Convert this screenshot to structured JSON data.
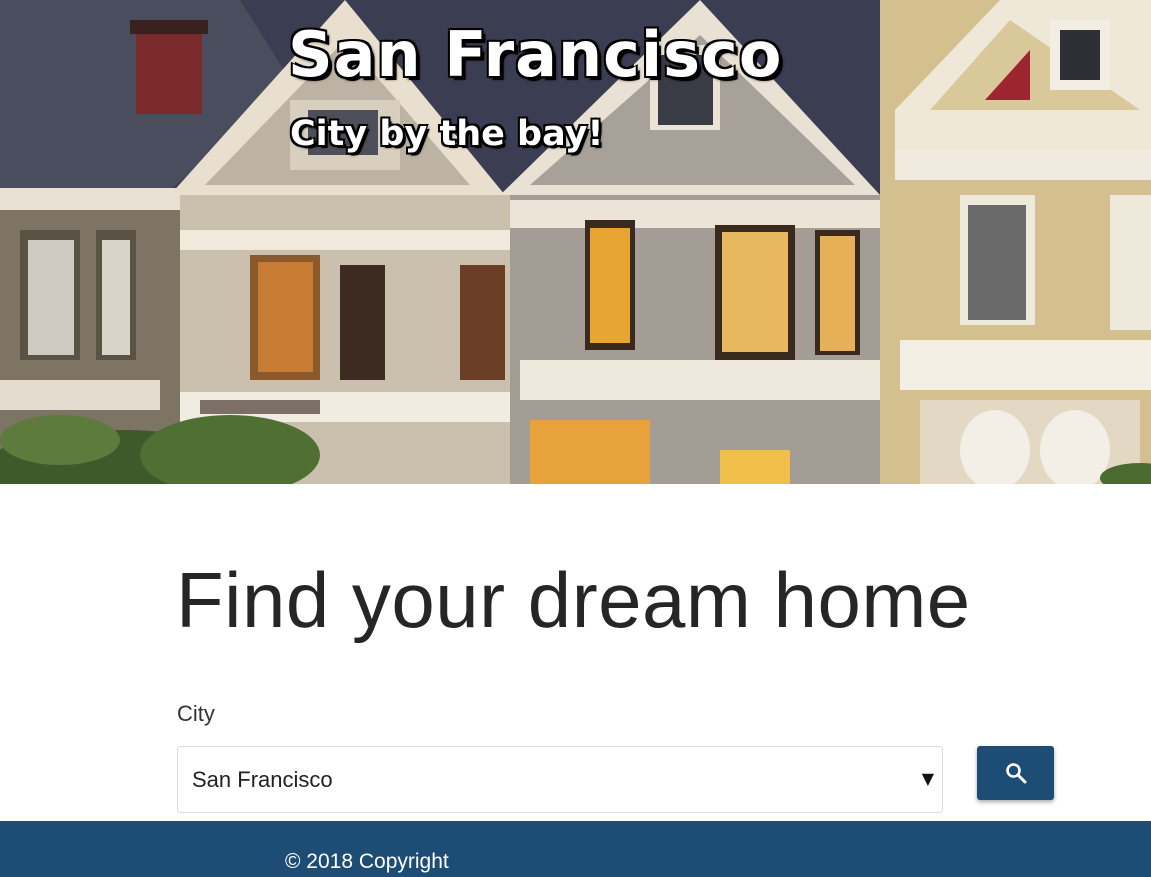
{
  "hero": {
    "title": "San Francisco",
    "subtitle": "City by the bay!",
    "image_subject": "painted-ladies-victorian-houses"
  },
  "main": {
    "heading": "Find your dream home",
    "city_label": "City",
    "city_select": {
      "selected": "San Francisco"
    },
    "search_button_icon": "search-icon"
  },
  "footer": {
    "copyright": "© 2018 Copyright"
  },
  "colors": {
    "primary": "#1d4d74",
    "heading_text": "#262626",
    "footer_text": "#ffffff"
  }
}
